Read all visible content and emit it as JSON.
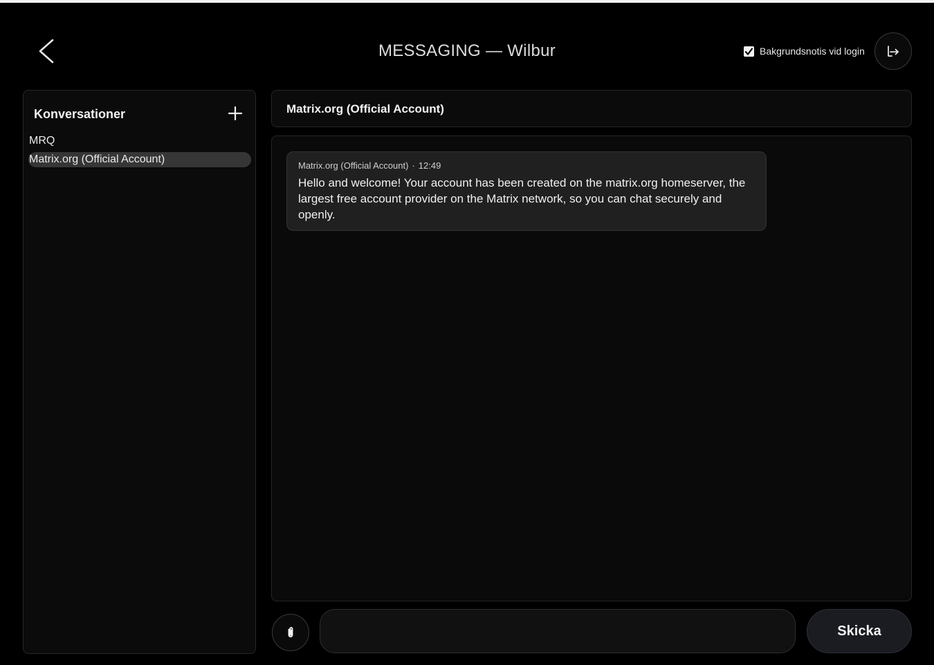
{
  "header": {
    "title": "MESSAGING — Wilbur",
    "background_notify_label": "Bakgrundsnotis vid login",
    "background_notify_checked": true,
    "icons": {
      "back": "chevron-left-icon",
      "logout": "logout-icon"
    }
  },
  "sidebar": {
    "title": "Konversationer",
    "add_icon": "plus-icon",
    "conversations": [
      {
        "label": "MRQ",
        "active": false
      },
      {
        "label": "Matrix.org (Official Account)",
        "active": true
      }
    ]
  },
  "conversation": {
    "title": "Matrix.org (Official Account)",
    "messages": [
      {
        "sender": "Matrix.org (Official Account)",
        "separator": "·",
        "time": "12:49",
        "text": "Hello and welcome! Your account has been created on the matrix.org homeserver, the largest free account provider on the Matrix network, so you can chat securely and openly."
      }
    ]
  },
  "composer": {
    "value": "",
    "placeholder": "",
    "send_label": "Skicka",
    "attach_icon": "paperclip-icon"
  },
  "colors": {
    "background": "#000000",
    "panel": "#0b0b0b",
    "bubble": "#202020",
    "active_item": "#363636",
    "send_button": "#1a1c22",
    "text": "#f0f0f0"
  }
}
